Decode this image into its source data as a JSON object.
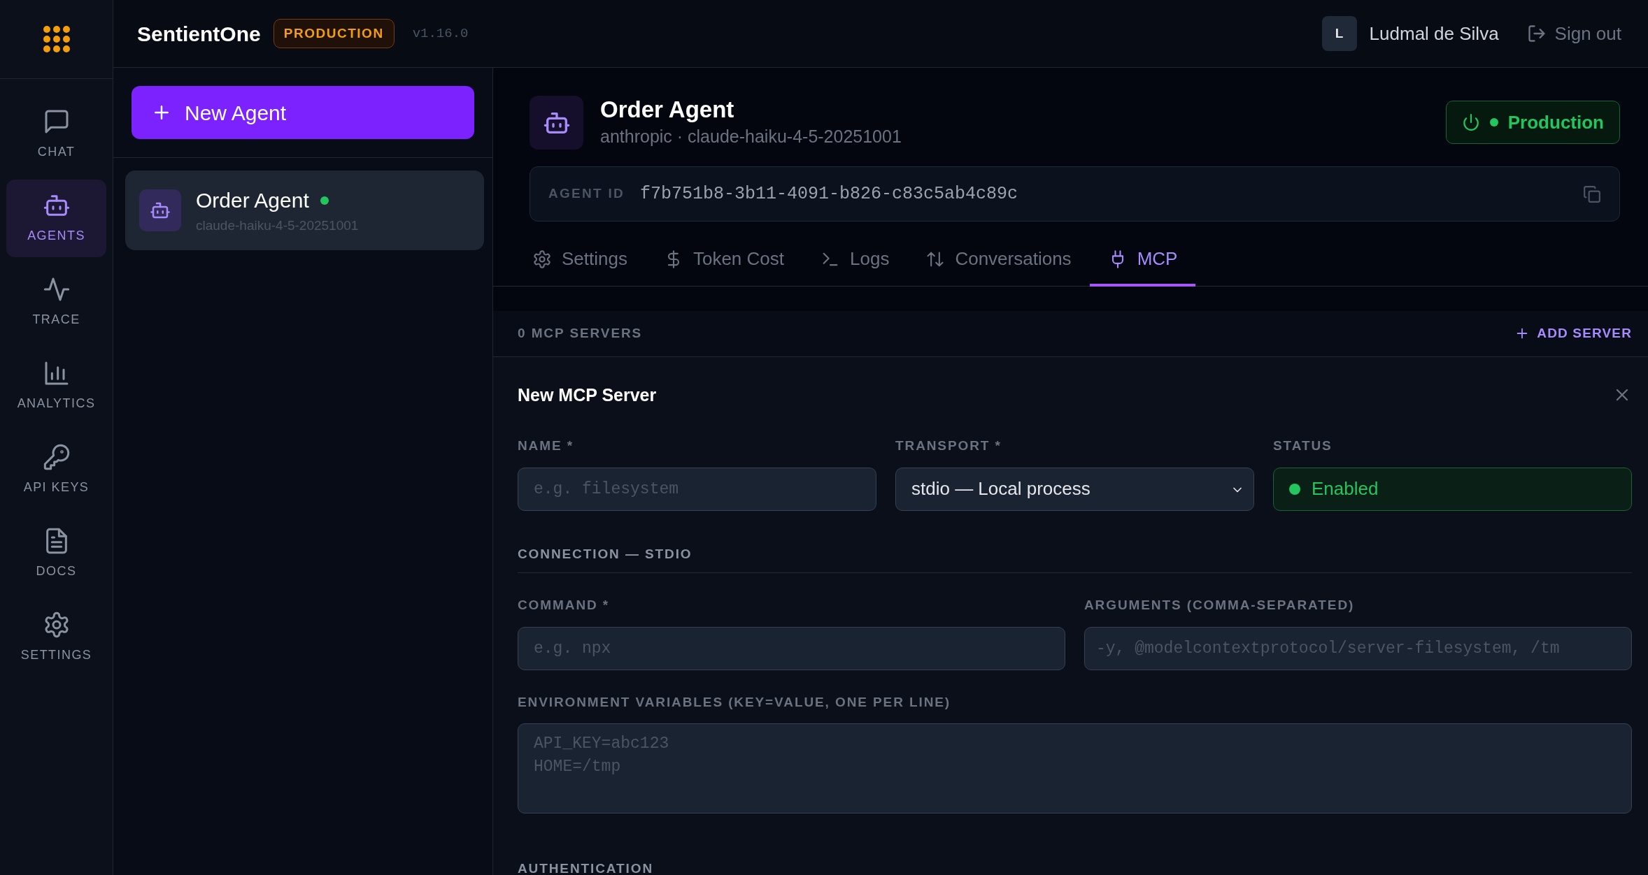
{
  "rail": {
    "items": [
      {
        "label": "CHAT",
        "selected": false
      },
      {
        "label": "AGENTS",
        "selected": true
      },
      {
        "label": "TRACE",
        "selected": false
      },
      {
        "label": "ANALYTICS",
        "selected": false
      },
      {
        "label": "API KEYS",
        "selected": false
      },
      {
        "label": "DOCS",
        "selected": false
      },
      {
        "label": "SETTINGS",
        "selected": false
      }
    ]
  },
  "header": {
    "app_name": "SentientOne",
    "env_badge": "PRODUCTION",
    "version": "v1.16.0",
    "user": {
      "initial": "L",
      "name": "Ludmal de Silva"
    },
    "sign_out": "Sign out"
  },
  "agents_panel": {
    "new_button": "New Agent",
    "agents": [
      {
        "name": "Order Agent",
        "model": "claude-haiku-4-5-20251001",
        "online": true,
        "selected": true
      }
    ]
  },
  "agent": {
    "name": "Order Agent",
    "subtitle": "anthropic · claude-haiku-4-5-20251001",
    "env_button": "Production",
    "live": true,
    "id_label": "AGENT ID",
    "id": "f7b751b8-3b11-4091-b826-c83c5ab4c89c"
  },
  "tabs": [
    {
      "label": "Settings",
      "selected": false
    },
    {
      "label": "Token Cost",
      "selected": false
    },
    {
      "label": "Logs",
      "selected": false
    },
    {
      "label": "Conversations",
      "selected": false
    },
    {
      "label": "MCP",
      "selected": true
    }
  ],
  "servers": {
    "count_label": "0 MCP SERVERS",
    "add_button": "ADD SERVER"
  },
  "form": {
    "title": "New MCP Server",
    "name": {
      "label": "NAME *",
      "placeholder": "e.g. filesystem"
    },
    "transport": {
      "label": "TRANSPORT *",
      "value": "stdio — Local process"
    },
    "status": {
      "label": "STATUS",
      "value": "Enabled",
      "enabled": true
    },
    "connection_title": "CONNECTION — STDIO",
    "command": {
      "label": "COMMAND *",
      "placeholder": "e.g. npx"
    },
    "arguments": {
      "label": "ARGUMENTS (COMMA-SEPARATED)",
      "placeholder": "-y, @modelcontextprotocol/server-filesystem, /tm"
    },
    "env": {
      "label": "ENVIRONMENT VARIABLES (KEY=VALUE, ONE PER LINE)",
      "placeholder": "API_KEY=abc123\nHOME=/tmp"
    },
    "auth_title": "AUTHENTICATION"
  }
}
